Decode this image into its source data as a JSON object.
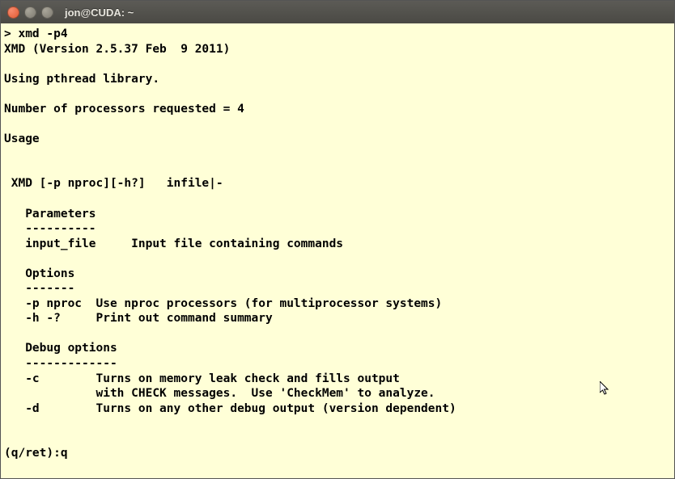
{
  "window": {
    "title": "jon@CUDA: ~"
  },
  "terminal": {
    "prompt": "> ",
    "command": "xmd -p4",
    "lines": [
      "XMD (Version 2.5.37 Feb  9 2011)",
      "",
      "Using pthread library.",
      "",
      "Number of processors requested = 4",
      "",
      "Usage",
      "",
      "",
      " XMD [-p nproc][-h?]   infile|-",
      "",
      "   Parameters",
      "   ----------",
      "   input_file     Input file containing commands",
      "",
      "   Options",
      "   -------",
      "   -p nproc  Use nproc processors (for multiprocessor systems)",
      "   -h -?     Print out command summary",
      "",
      "   Debug options",
      "   -------------",
      "   -c        Turns on memory leak check and fills output",
      "             with CHECK messages.  Use 'CheckMem' to analyze.",
      "   -d        Turns on any other debug output (version dependent)",
      "",
      ""
    ],
    "pager_prompt": "(q/ret):",
    "pager_input": "q"
  }
}
